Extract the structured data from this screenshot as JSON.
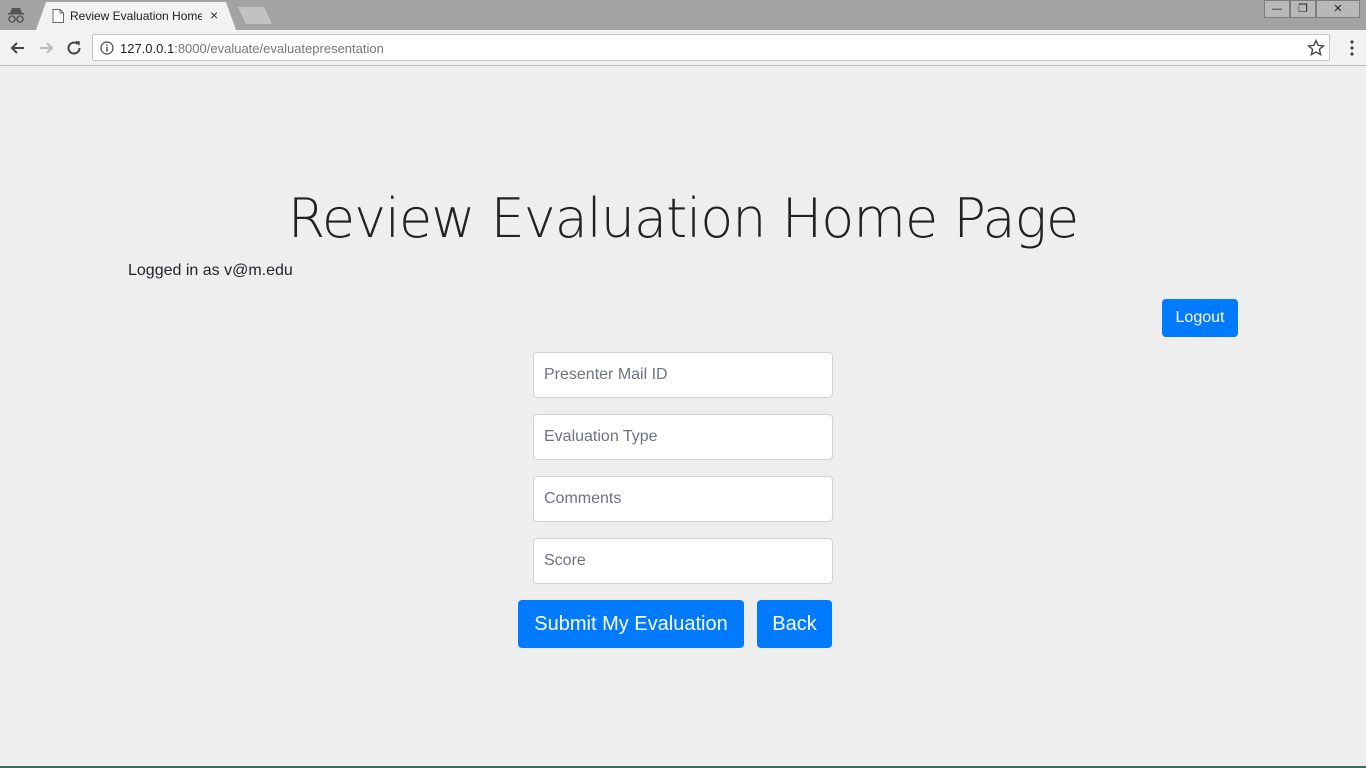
{
  "browser": {
    "tab_title": "Review Evaluation Home",
    "tab_close": "×",
    "url_host": "127.0.0.1",
    "url_path": ":8000/evaluate/evaluatepresentation",
    "window_controls": {
      "minimize": "—",
      "restore": "❐",
      "close": "✕"
    }
  },
  "page": {
    "title": "Review Evaluation Home Page",
    "logged_in_text": "Logged in as v@m.edu",
    "logout_label": "Logout"
  },
  "form": {
    "presenter_placeholder": "Presenter Mail ID",
    "evaluation_type_placeholder": "Evaluation Type",
    "comments_placeholder": "Comments",
    "score_placeholder": "Score",
    "submit_label": "Submit My Evaluation",
    "back_label": "Back"
  },
  "colors": {
    "primary": "#007bff",
    "background": "#eeeeee",
    "tabstrip": "#a3a3a3"
  }
}
